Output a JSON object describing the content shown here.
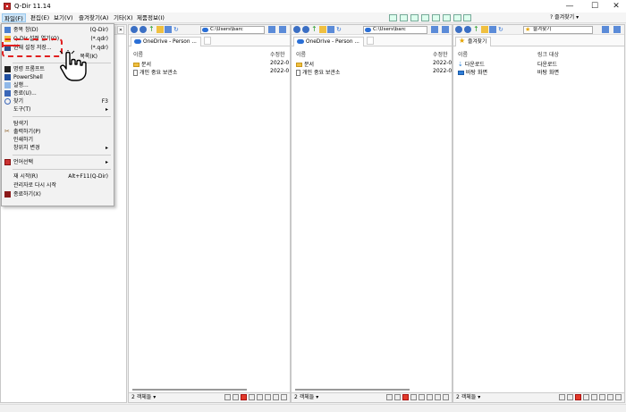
{
  "window": {
    "title": "Q-Dir 11.14",
    "controls": {
      "minimize": "—",
      "maximize": "☐",
      "close": "✕"
    }
  },
  "menubar": {
    "items": [
      "파일(F)",
      "편집(E)",
      "보기(V)",
      "즐겨찾기(A)",
      "기타(X)",
      "제품정보(I)"
    ],
    "favorites_button": "즐겨찾기"
  },
  "file_menu": {
    "items": [
      {
        "label": "중복 창(D)",
        "shortcut": "(Q-Dir)",
        "icon": "duplicate-window-icon"
      },
      {
        "label": "Q-Dir 설정 열기(O)",
        "shortcut": "(*.qdr)",
        "icon": "open-folder-icon"
      },
      {
        "label": "현재 설정 저장...",
        "shortcut": "(*.qdr)",
        "icon": "save-disk-icon"
      },
      {
        "label": "",
        "shortcut": "목록(K)",
        "icon": ""
      },
      {
        "label": "명령 프롬프트",
        "shortcut": "",
        "icon": "terminal-icon"
      },
      {
        "label": "PowerShell",
        "shortcut": "",
        "icon": "powershell-icon"
      },
      {
        "label": "실행...",
        "shortcut": "",
        "icon": "run-icon"
      },
      {
        "label": "종료(U)...",
        "shortcut": "",
        "icon": "shutdown-icon"
      },
      {
        "label": "찾기",
        "shortcut": "F3",
        "icon": "search-icon"
      },
      {
        "label": "도구(T)",
        "shortcut": "▸",
        "icon": ""
      },
      {
        "label": "탐색기",
        "shortcut": "",
        "icon": ""
      },
      {
        "label": "출력하기(P)",
        "shortcut": "",
        "icon": "print-icon"
      },
      {
        "label": "인쇄하기",
        "shortcut": "",
        "icon": ""
      },
      {
        "label": "창위치 변경",
        "shortcut": "▸",
        "icon": ""
      },
      {
        "label": "언어선택",
        "shortcut": "▸",
        "icon": "language-icon"
      },
      {
        "label": "재 시작(R)",
        "shortcut": "Alt+F11(Q-Dir)",
        "icon": ""
      },
      {
        "label": "관리자로 다시 시작",
        "shortcut": "",
        "icon": ""
      },
      {
        "label": "종료하기(X)",
        "shortcut": "",
        "icon": "exit-icon"
      }
    ]
  },
  "panes": [
    {
      "address": "C:\\Users\\barc",
      "tab_label": "OneDrive - Person ...",
      "col_name": "이름",
      "col_date": "수정한",
      "rows": [
        {
          "name": "문서",
          "date": "2022-0",
          "type": "folder"
        },
        {
          "name": "개인 중요 보관소",
          "date": "2022-0",
          "type": "doc"
        }
      ],
      "status": "2 객체들 ▾"
    },
    {
      "address": "C:\\Users\\barc",
      "tab_label": "OneDrive - Person ...",
      "col_name": "이름",
      "col_date": "수정한",
      "rows": [
        {
          "name": "문서",
          "date": "2022-0",
          "type": "folder"
        },
        {
          "name": "개인 중요 보관소",
          "date": "2022-0",
          "type": "doc"
        }
      ],
      "status": "2 객체들 ▾"
    },
    {
      "address": "즐겨찾기",
      "tab_label": "즐겨찾기",
      "col_name": "이름",
      "col_date": "링크 대상",
      "rows": [
        {
          "name": "다운로드",
          "date": "다운로드",
          "type": "download"
        },
        {
          "name": "바탕 화면",
          "date": "바탕 화면",
          "type": "desktop"
        }
      ],
      "status": "2 객체들 ▾"
    }
  ],
  "pane0_close": "✕"
}
